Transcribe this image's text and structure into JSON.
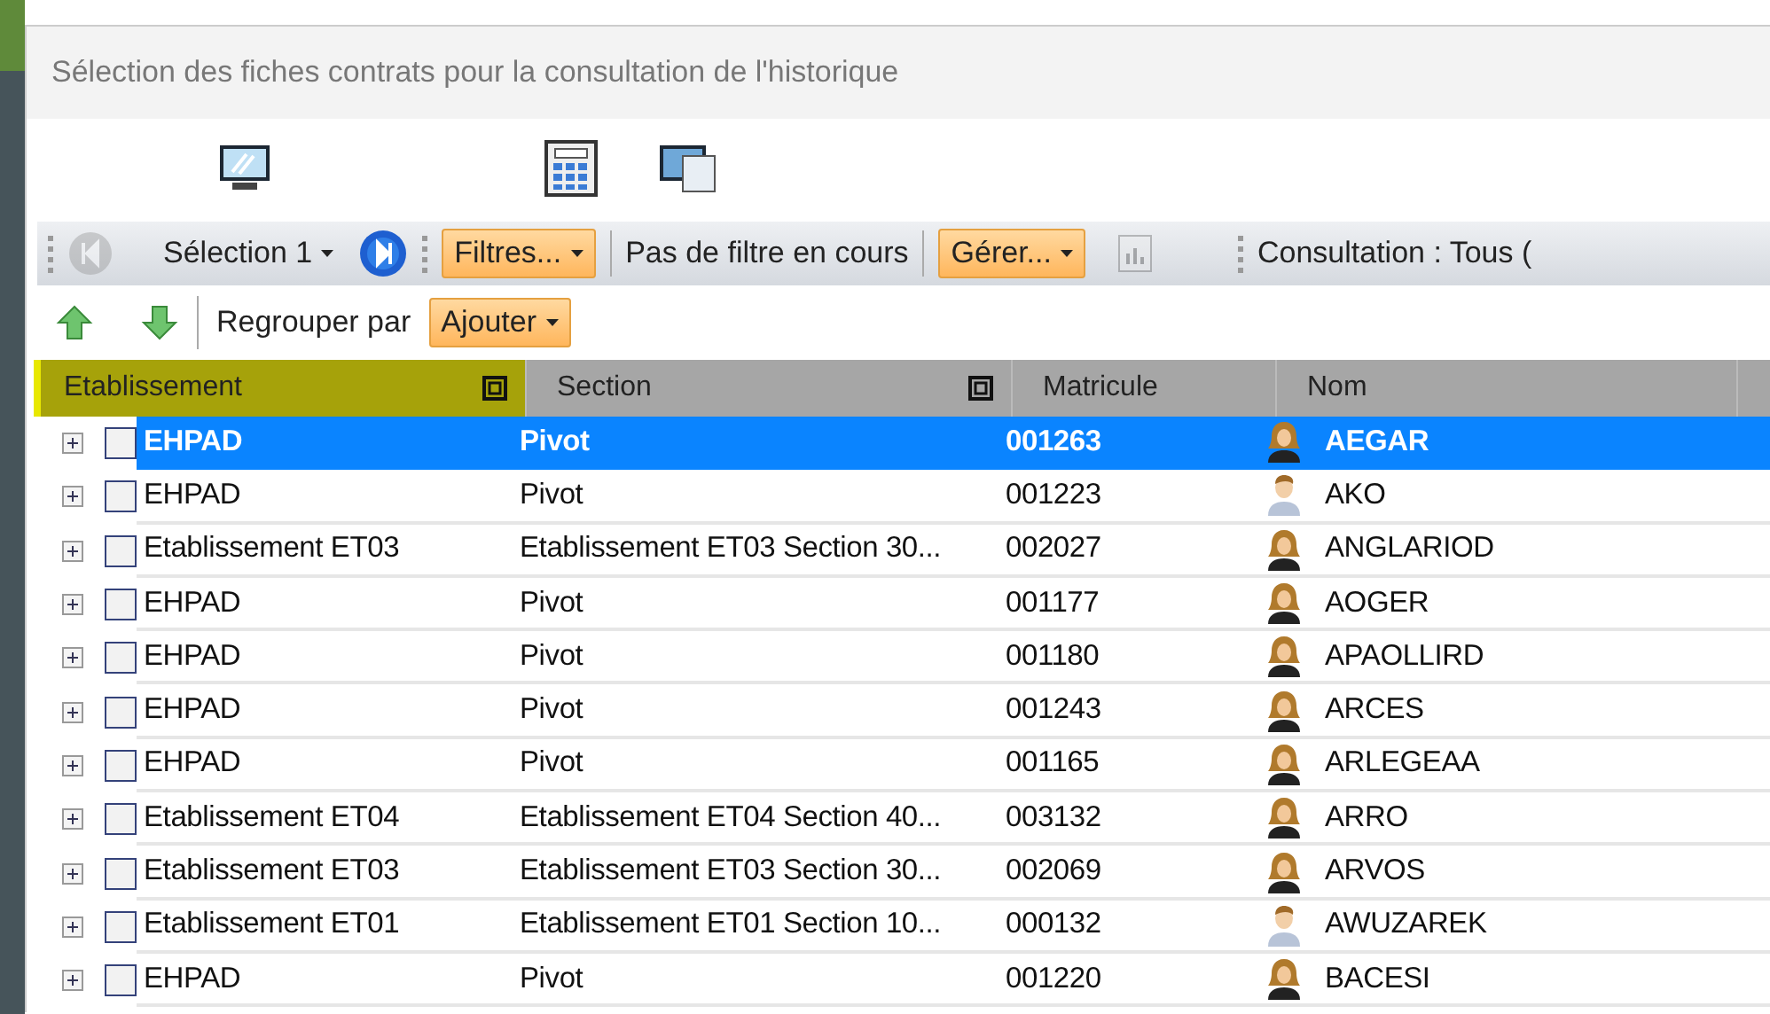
{
  "window": {
    "title": "Sélection des fiches contrats pour la consultation de l'historique"
  },
  "toolbar": {
    "first_disabled": true,
    "selection": "Sélection 1",
    "filters": "Filtres...",
    "filter_status": "Pas de filtre en cours",
    "manage": "Gérer...",
    "stats_disabled": true,
    "consultation": "Consultation : Tous ("
  },
  "group_bar": {
    "label": "Regrouper par",
    "add": "Ajouter"
  },
  "table": {
    "columns": [
      {
        "label": "Etablissement",
        "highlighted": true
      },
      {
        "label": "Section",
        "highlighted": false
      },
      {
        "label": "Matricule",
        "highlighted": false
      },
      {
        "label": "Nom",
        "highlighted": false
      }
    ],
    "rows": [
      {
        "selected": true,
        "checked": false,
        "etablissement": "EHPAD",
        "section": "Pivot",
        "matricule": "001263",
        "female": true,
        "nom": "AEGAR"
      },
      {
        "selected": false,
        "checked": false,
        "etablissement": "EHPAD",
        "section": "Pivot",
        "matricule": "001223",
        "female": false,
        "nom": "AKO"
      },
      {
        "selected": false,
        "checked": false,
        "etablissement": "Etablissement ET03",
        "section": "Etablissement ET03 Section 30...",
        "matricule": "002027",
        "female": true,
        "nom": "ANGLARIOD"
      },
      {
        "selected": false,
        "checked": false,
        "etablissement": "EHPAD",
        "section": "Pivot",
        "matricule": "001177",
        "female": true,
        "nom": "AOGER"
      },
      {
        "selected": false,
        "checked": false,
        "etablissement": "EHPAD",
        "section": "Pivot",
        "matricule": "001180",
        "female": true,
        "nom": "APAOLLIRD"
      },
      {
        "selected": false,
        "checked": false,
        "etablissement": "EHPAD",
        "section": "Pivot",
        "matricule": "001243",
        "female": true,
        "nom": "ARCES"
      },
      {
        "selected": false,
        "checked": false,
        "etablissement": "EHPAD",
        "section": "Pivot",
        "matricule": "001165",
        "female": true,
        "nom": "ARLEGEAA"
      },
      {
        "selected": false,
        "checked": false,
        "etablissement": "Etablissement ET04",
        "section": "Etablissement ET04 Section 40...",
        "matricule": "003132",
        "female": true,
        "nom": "ARRO"
      },
      {
        "selected": false,
        "checked": false,
        "etablissement": "Etablissement ET03",
        "section": "Etablissement ET03 Section 30...",
        "matricule": "002069",
        "female": true,
        "nom": "ARVOS"
      },
      {
        "selected": false,
        "checked": false,
        "etablissement": "Etablissement ET01",
        "section": "Etablissement ET01 Section 10...",
        "matricule": "000132",
        "female": false,
        "nom": "AWUZAREK"
      },
      {
        "selected": false,
        "checked": false,
        "etablissement": "EHPAD",
        "section": "Pivot",
        "matricule": "001220",
        "female": true,
        "nom": "BACESI"
      }
    ]
  }
}
